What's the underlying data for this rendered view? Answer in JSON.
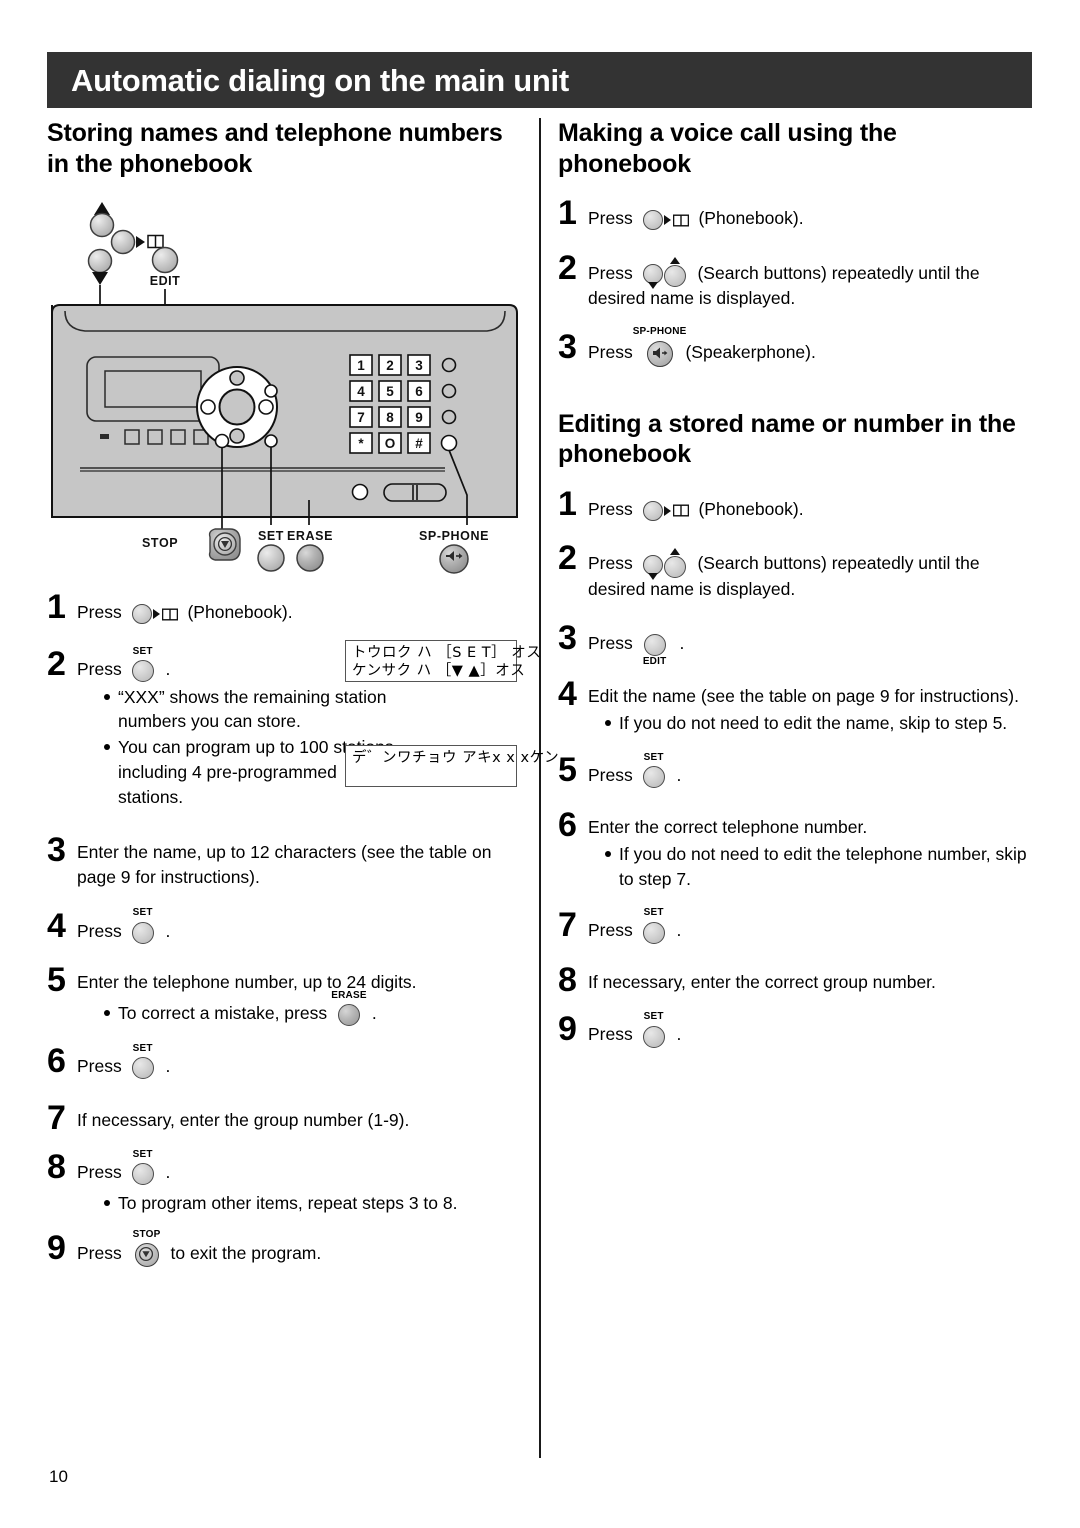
{
  "header": {
    "title": "Automatic dialing on the main unit",
    "bar_color": "#333333",
    "text_color": "#ffffff"
  },
  "page": {
    "number": "10"
  },
  "icons": {
    "phonebook": "phonebook-book-icon",
    "search_up": "search-up-arrow-icon",
    "search_down": "search-down-arrow-icon",
    "speakerphone": "speakerphone-icon",
    "stop": "stop-icon"
  },
  "labels": {
    "set": "SET",
    "erase": "ERASE",
    "edit": "EDIT",
    "stop": "STOP",
    "sp_phone": "SP-PHONE",
    "press": "Press",
    "phonebook_paren": "(Phonebook).",
    "search_paren": "(Search buttons) repeatedly until the",
    "speakerphone_paren": "(Speakerphone).",
    "period": "."
  },
  "device_diagram": {
    "name": "main-unit-control-panel-illustration",
    "callout_labels": {
      "edit": "EDIT",
      "stop": "STOP",
      "set": "SET",
      "erase": "ERASE",
      "sp_phone": "SP-PHONE"
    },
    "keypad": [
      [
        "1",
        "2",
        "3"
      ],
      [
        "4",
        "5",
        "6"
      ],
      [
        "7",
        "8",
        "9"
      ],
      [
        "*",
        "O",
        "#"
      ]
    ]
  },
  "left_column": {
    "section_title": "Storing names and telephone numbers in the phonebook",
    "steps": [
      {
        "num": "1",
        "pre": "Press",
        "button": "phonebook",
        "post": "(Phonebook).",
        "bullets": []
      },
      {
        "num": "2",
        "pre": "Press",
        "button": "set",
        "button_label": "SET",
        "post": ".",
        "bullets": [
          "“XXX” shows the remaining station numbers you can store.",
          "You can program up to 100 stations, including 4 pre-programmed stations."
        ]
      },
      {
        "num": "3",
        "text": "Enter the name, up to 12 characters (see the table on page 9 for instructions).",
        "bullets": []
      },
      {
        "num": "4",
        "pre": "Press",
        "button": "set",
        "button_label": "SET",
        "post": ".",
        "bullets": []
      },
      {
        "num": "5",
        "text": "Enter the telephone number, up to 24 digits.",
        "bullet_pre": "To correct a mistake, press",
        "bullet_button_label": "ERASE",
        "bullet_post": "."
      },
      {
        "num": "6",
        "pre": "Press",
        "button": "set",
        "button_label": "SET",
        "post": ".",
        "bullets": []
      },
      {
        "num": "7",
        "text": "If necessary, enter the group number (1-9).",
        "bullets": []
      },
      {
        "num": "8",
        "pre": "Press",
        "button": "set",
        "button_label": "SET",
        "post": ".",
        "bullets": [
          "To program other items, repeat steps 3 to 8."
        ]
      },
      {
        "num": "9",
        "pre": "Press",
        "button": "stop",
        "button_label": "STOP",
        "post": "to exit the program.",
        "bullets": []
      }
    ],
    "lcd_1": {
      "line1": "トウロク ハ ［S E T］ オス",
      "line2": "ケンサク ハ ［▼ ▲］オス"
    },
    "lcd_2": {
      "line1": "デ゛ンワチョウ アキx x xケン",
      "line2": ""
    }
  },
  "right_column": {
    "section_title_1": "Making a voice call using the phonebook",
    "steps_1": [
      {
        "num": "1",
        "pre": "Press",
        "button": "phonebook",
        "post": "(Phonebook)."
      },
      {
        "num": "2",
        "pre": "Press",
        "button": "search",
        "post": "(Search buttons) repeatedly until the",
        "post2": "desired name is displayed."
      },
      {
        "num": "3",
        "pre": "Press",
        "button": "sp-phone",
        "button_label": "SP-PHONE",
        "post": "(Speakerphone)."
      }
    ],
    "section_title_2": "Editing a stored name or number in the phonebook",
    "steps_2": [
      {
        "num": "1",
        "pre": "Press",
        "button": "phonebook",
        "post": "(Phonebook)."
      },
      {
        "num": "2",
        "pre": "Press",
        "button": "search",
        "post": "(Search buttons) repeatedly until the",
        "post2": "desired name is displayed."
      },
      {
        "num": "3",
        "pre": "Press",
        "button": "edit",
        "button_label": "EDIT",
        "post": "."
      },
      {
        "num": "4",
        "text": "Edit the name (see the table on page 9 for instructions).",
        "bullets": [
          "If you do not need to edit the name, skip to step 5."
        ]
      },
      {
        "num": "5",
        "pre": "Press",
        "button": "set",
        "button_label": "SET",
        "post": "."
      },
      {
        "num": "6",
        "text": "Enter the correct telephone number.",
        "bullets": [
          "If you do not need to edit the telephone number, skip to step 7."
        ]
      },
      {
        "num": "7",
        "pre": "Press",
        "button": "set",
        "button_label": "SET",
        "post": "."
      },
      {
        "num": "8",
        "text": "If necessary, enter the correct group number."
      },
      {
        "num": "9",
        "pre": "Press",
        "button": "set",
        "button_label": "SET",
        "post": "."
      }
    ]
  }
}
